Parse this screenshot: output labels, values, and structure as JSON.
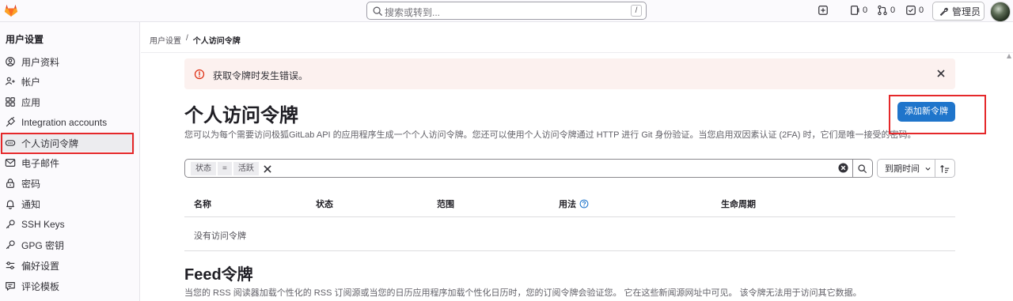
{
  "topbar": {
    "search_placeholder": "搜索或转到...",
    "search_shortcut": "/",
    "issues_count": "0",
    "mr_count": "0",
    "todos_count": "0",
    "admin_label": "管理员"
  },
  "sidebar": {
    "title": "用户设置",
    "items": [
      {
        "label": "用户资料",
        "icon": "user-icon"
      },
      {
        "label": "帐户",
        "icon": "account-icon"
      },
      {
        "label": "应用",
        "icon": "applications-icon"
      },
      {
        "label": "Integration accounts",
        "icon": "plug-icon"
      },
      {
        "label": "个人访问令牌",
        "icon": "token-icon",
        "active": true
      },
      {
        "label": "电子邮件",
        "icon": "mail-icon"
      },
      {
        "label": "密码",
        "icon": "lock-icon"
      },
      {
        "label": "通知",
        "icon": "bell-icon"
      },
      {
        "label": "SSH Keys",
        "icon": "key-icon"
      },
      {
        "label": "GPG 密钥",
        "icon": "key-icon"
      },
      {
        "label": "偏好设置",
        "icon": "preferences-icon"
      },
      {
        "label": "评论模板",
        "icon": "comment-icon"
      }
    ]
  },
  "breadcrumb": {
    "parent": "用户设置",
    "separator": "/",
    "current": "个人访问令牌"
  },
  "alert": {
    "message": "获取令牌时发生错误。"
  },
  "page": {
    "title": "个人访问令牌",
    "description": "您可以为每个需要访问极狐GitLab API 的应用程序生成一个个人访问令牌。您还可以使用个人访问令牌通过 HTTP 进行 Git 身份验证。当您启用双因素认证 (2FA) 时，它们是唯一接受的密码。",
    "add_button": "添加新令牌"
  },
  "filter": {
    "token_key": "状态",
    "token_op": "=",
    "token_value": "活跃",
    "sort_label": "到期时间"
  },
  "table": {
    "headers": [
      "名称",
      "状态",
      "范围",
      "用法",
      "生命周期"
    ],
    "empty_text": "没有访问令牌"
  },
  "feed": {
    "title": "Feed令牌",
    "description": "当您的 RSS 阅读器加载个性化的 RSS 订阅源或当您的日历应用程序加载个性化日历时，您的订阅令牌会验证您。 它在这些新闻源网址中可见。 该令牌无法用于访问其它数据。"
  },
  "colors": {
    "primary": "#1f75cb",
    "highlight_box": "#e5282a",
    "alert_bg": "#fcf1ef",
    "alert_icon": "#dd2b0e"
  }
}
